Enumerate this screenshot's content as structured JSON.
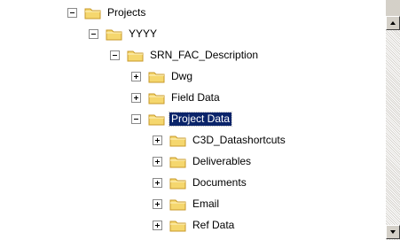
{
  "tree": {
    "nodes": [
      {
        "label": "Projects",
        "toggle": "minus",
        "level": 0,
        "selected": false
      },
      {
        "label": "YYYY",
        "toggle": "minus",
        "level": 1,
        "selected": false
      },
      {
        "label": "SRN_FAC_Description",
        "toggle": "minus",
        "level": 2,
        "selected": false
      },
      {
        "label": "Dwg",
        "toggle": "plus",
        "level": 3,
        "selected": false
      },
      {
        "label": "Field Data",
        "toggle": "plus",
        "level": 3,
        "selected": false
      },
      {
        "label": "Project Data",
        "toggle": "minus",
        "level": 3,
        "selected": true
      },
      {
        "label": "C3D_Datashortcuts",
        "toggle": "plus",
        "level": 4,
        "selected": false
      },
      {
        "label": "Deliverables",
        "toggle": "plus",
        "level": 4,
        "selected": false
      },
      {
        "label": "Documents",
        "toggle": "plus",
        "level": 4,
        "selected": false
      },
      {
        "label": "Email",
        "toggle": "plus",
        "level": 4,
        "selected": false
      },
      {
        "label": "Ref Data",
        "toggle": "plus",
        "level": 4,
        "selected": false
      }
    ]
  },
  "icons": {
    "toggle_expanded": "minus-box-icon",
    "toggle_collapsed": "plus-box-icon",
    "folder": "folder-icon",
    "scroll_up": "arrow-up-icon",
    "scroll_down": "arrow-down-icon"
  },
  "colors": {
    "selection_bg": "#0a246a",
    "selection_fg": "#ffffff",
    "folder_fill": "#f5d76e",
    "folder_edge": "#c89a2a"
  }
}
